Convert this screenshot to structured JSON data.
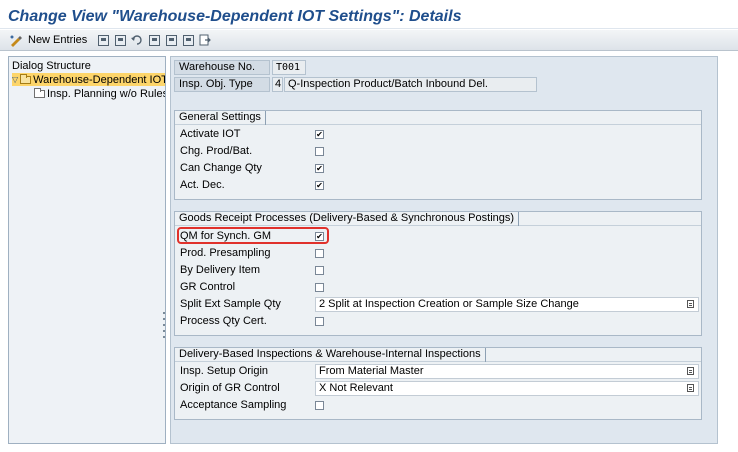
{
  "window": {
    "title": "Change View \"Warehouse-Dependent IOT Settings\": Details"
  },
  "toolbar": {
    "new_entries_label": "New Entries",
    "icons": [
      "change-display-icon",
      "copy-icon",
      "save-icon",
      "undo-icon",
      "previous-entry-icon",
      "next-entry-icon",
      "select-block-icon",
      "export-icon"
    ]
  },
  "tree": {
    "header": "Dialog Structure",
    "items": [
      {
        "label": "Warehouse-Dependent IOT Set",
        "selected": true,
        "expanded": true
      },
      {
        "label": "Insp. Planning w/o Rules",
        "selected": false
      }
    ]
  },
  "header_fields": {
    "warehouse_label": "Warehouse No.",
    "warehouse_value": "T001",
    "insp_obj_type_label": "Insp. Obj. Type",
    "insp_obj_type_code": "4",
    "insp_obj_type_desc": "Q-Inspection Product/Batch Inbound Del."
  },
  "general_settings": {
    "title": "General Settings",
    "rows": [
      {
        "label": "Activate IOT",
        "checked": true
      },
      {
        "label": "Chg. Prod/Bat.",
        "checked": false
      },
      {
        "label": "Can Change Qty",
        "checked": true
      },
      {
        "label": "Act. Dec.",
        "checked": true
      }
    ]
  },
  "goods_receipt": {
    "title": "Goods Receipt Processes (Delivery-Based & Synchronous Postings)",
    "rows": [
      {
        "label": "QM for Synch. GM",
        "checked": true,
        "highlighted": true
      },
      {
        "label": "Prod. Presampling",
        "checked": false
      },
      {
        "label": "By Delivery Item",
        "checked": false
      },
      {
        "label": "GR Control",
        "checked": false
      }
    ],
    "split_label": "Split Ext Sample Qty",
    "split_value": "2 Split at Inspection Creation or Sample Size Change",
    "process_qty_label": "Process Qty Cert.",
    "process_qty_checked": false
  },
  "delivery_based": {
    "title": "Delivery-Based Inspections & Warehouse-Internal Inspections",
    "insp_setup_label": "Insp. Setup Origin",
    "insp_setup_value": "From Material Master",
    "gr_origin_label": "Origin of GR Control",
    "gr_origin_value": "X Not Relevant",
    "acceptance_label": "Acceptance Sampling",
    "acceptance_checked": false
  },
  "colors": {
    "title_blue": "#1f4e8c",
    "highlight_red": "#e0312b",
    "tree_selected": "#fdd56a",
    "panel_bg": "#dfe7ef"
  }
}
